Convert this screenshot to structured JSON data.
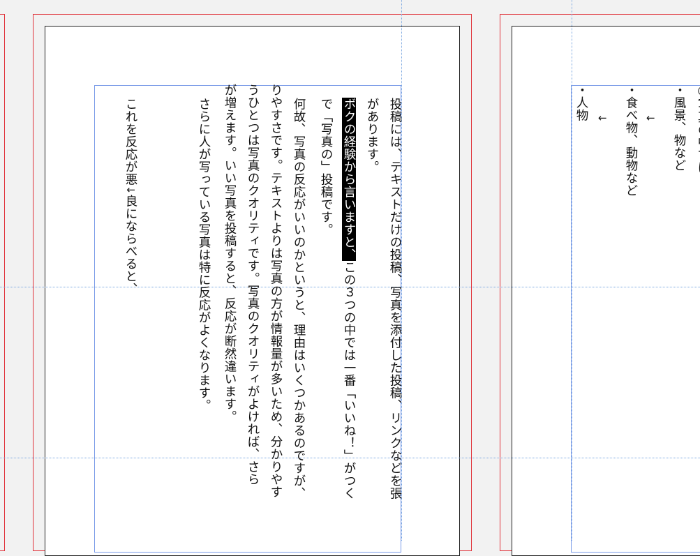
{
  "left_page": {
    "lines": [
      "投稿には、テキストだけの投稿、写真を添付した投稿、リンクなどを張",
      "があります。",
      "この３つの中では一番「いいね！」がつく",
      "で「写真の」投稿です。",
      "何故、写真の反応がいいのかというと、理由はいくつかあるのですが、",
      "りやすさです。テキストよりは写真の方が情報量が多いため、分かりやす",
      "うひとつは写真のクオリティです。写真のクオリティがよければ、さら",
      "が増えます。いい写真を投稿すると、反応が断然違います。",
      "さらに人が写っている写真は特に反応がよくなります。",
      "これを反応が悪",
      "良にならべると、"
    ],
    "highlight": "ボクの経験から言いますと、",
    "arrow_down": "↓"
  },
  "right_page": {
    "lines": [
      "○写真の中では",
      "・風景、物など",
      "・食べ物、動物など",
      "・人物"
    ],
    "arrow_left": "←"
  }
}
